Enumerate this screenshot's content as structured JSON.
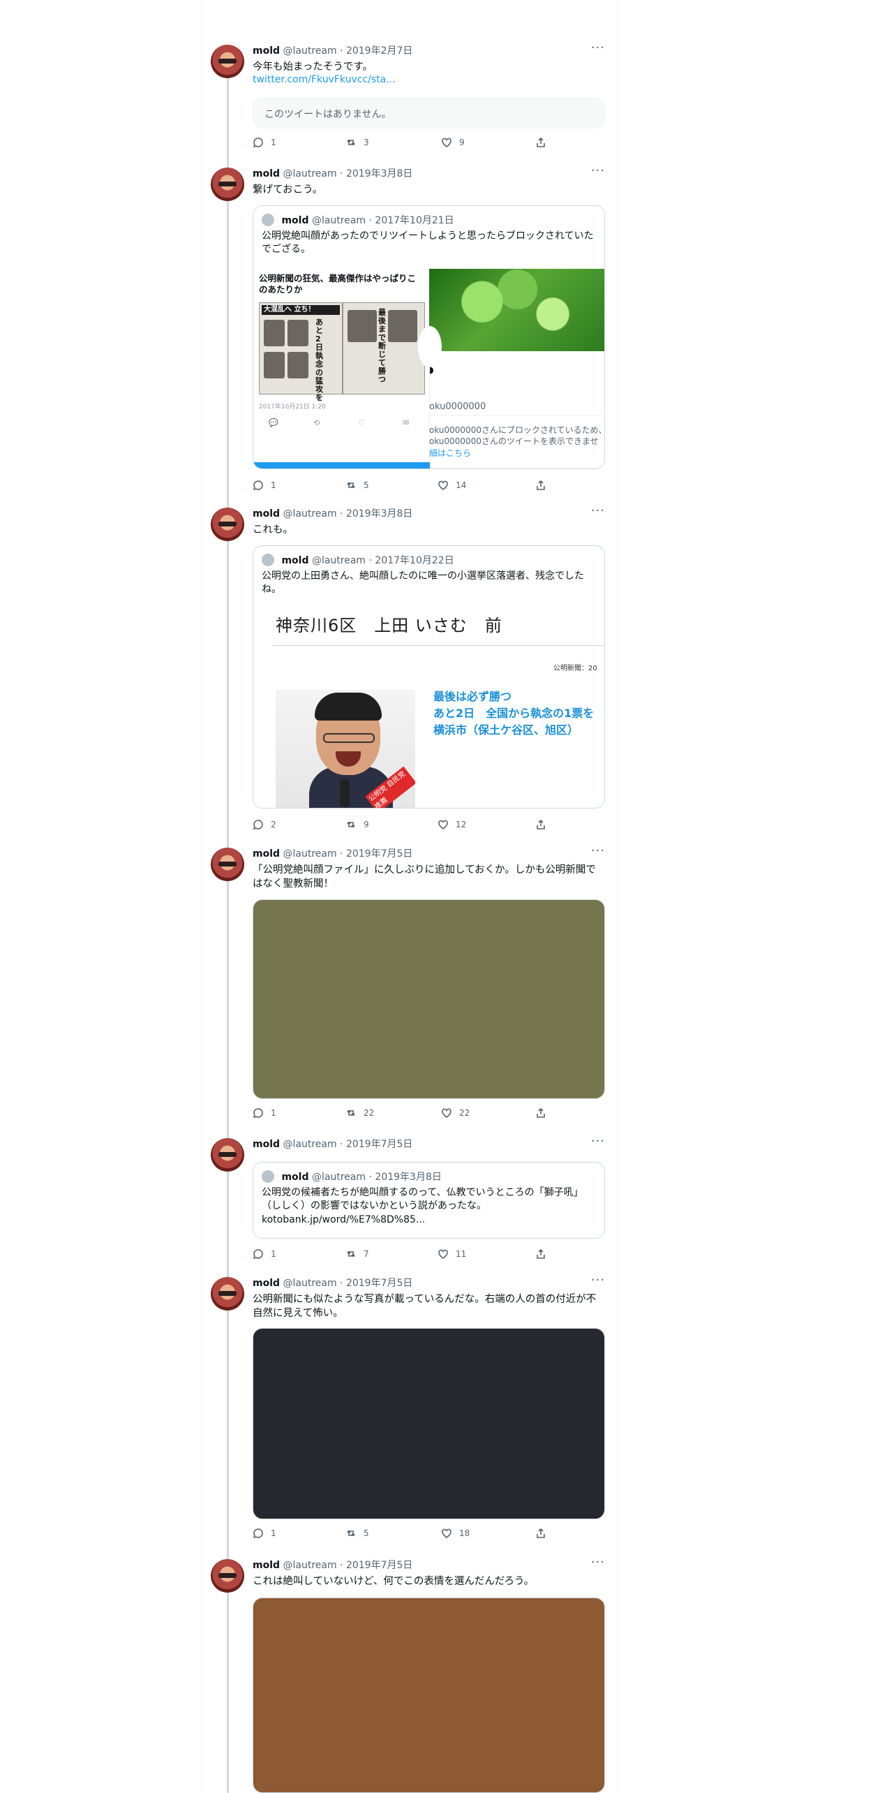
{
  "handle": "@lautream",
  "tweets": [
    {
      "name": "mold",
      "handle": "@lautream",
      "date": "2019年2月7日",
      "text": "今年も始まったそうです。",
      "link": "twitter.com/FkuvFkuvcc/sta...",
      "unavailable": "このツイートはありません。",
      "replies": "1",
      "retweets": "3",
      "likes": "9"
    },
    {
      "name": "mold",
      "handle": "@lautream",
      "date": "2019年3月8日",
      "text": "繋げておこう。",
      "quote": {
        "name": "mold",
        "handle": "@lautream",
        "date": "2017年10月21日",
        "text": "公明党絶叫顔があったのでリツイートしようと思ったらブロックされていたでござる。",
        "card_title": "公明新聞の狂気、最高傑作はやっぱりこのあたりか",
        "clip1_head": "大混乱へ 立ち！",
        "clip1_vertical": "あと2日 執念の猛攻を",
        "clip2_vertical": "最後まで断じて勝つ",
        "card_timestamp": "2017年10月21日 1:20",
        "blocked_account": "oku0000000",
        "blocked_message_1": "oku0000000さんにブロックされているため、",
        "blocked_message_2": "oku0000000さんのツイートを表示できませ",
        "blocked_link": "細はこちら",
        "progress": 0.5
      },
      "replies": "1",
      "retweets": "5",
      "likes": "14"
    },
    {
      "name": "mold",
      "handle": "@lautream",
      "date": "2019年3月8日",
      "text": "これも。",
      "quote": {
        "name": "mold",
        "handle": "@lautream",
        "date": "2017年10月22日",
        "text": "公明党の上田勇さん、絶叫顔したのに唯一の小選挙区落選者、残念でしたね。",
        "flyer_title": "神奈川6区　上田 いさむ　前",
        "flyer_source": "公明新聞：20",
        "flyer_blue": "最後は必ず勝つ\nあと2日　全国から執念の1票を\n横浜市（保土ケ谷区、旭区）",
        "sash": "公明党 自民党推薦"
      },
      "replies": "2",
      "retweets": "9",
      "likes": "12"
    },
    {
      "name": "mold",
      "handle": "@lautream",
      "date": "2019年7月5日",
      "text": "「公明党絶叫顔ファイル」に久しぶりに追加しておくか。しかも公明新聞ではなく聖教新聞！",
      "media_color": "#75754e",
      "replies": "1",
      "retweets": "22",
      "likes": "22"
    },
    {
      "name": "mold",
      "handle": "@lautream",
      "date": "2019年7月5日",
      "text": "",
      "quote": {
        "name": "mold",
        "handle": "@lautream",
        "date": "2019年3月8日",
        "text": "公明党の候補者たちが絶叫顔するのって、仏教でいうところの「獅子吼」（ししく）の影響ではないかという説があったな。",
        "link": "kotobank.jp/word/%E7%8D%85..."
      },
      "replies": "1",
      "retweets": "7",
      "likes": "11"
    },
    {
      "name": "mold",
      "handle": "@lautream",
      "date": "2019年7月5日",
      "text": "公明新聞にも似たような写真が載っているんだな。右端の人の首の付近が不自然に見えて怖い。",
      "media_color": "#272730",
      "replies": "1",
      "retweets": "5",
      "likes": "18"
    },
    {
      "name": "mold",
      "handle": "@lautream",
      "date": "2019年7月5日",
      "text": "これは絶叫していないけど、何でこの表情を選んだんだろう。",
      "media_color": "#8e5a33"
    }
  ]
}
